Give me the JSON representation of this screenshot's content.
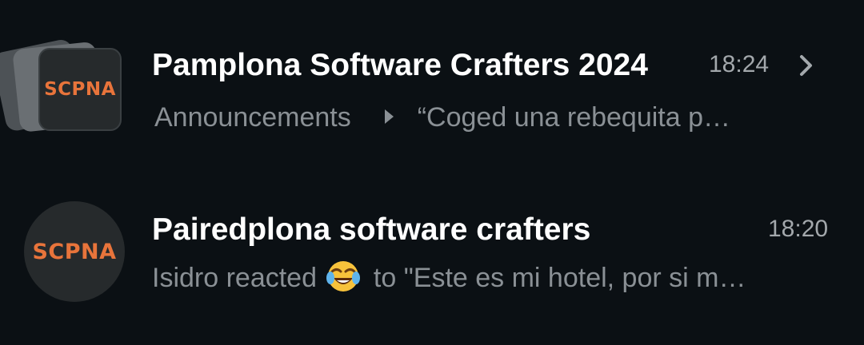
{
  "colors": {
    "background": "#0b1014",
    "title": "#ffffff",
    "secondary": "#8a9095",
    "time": "#a3a8ac",
    "logo_orange": "#e8743b",
    "avatar_bg": "#262a2c"
  },
  "chats": [
    {
      "type": "community",
      "avatar_text": "SCPNA",
      "title": "Pamplona Software Crafters 2024",
      "time": "18:24",
      "subgroup": "Announcements",
      "preview": "“Coged una rebequita p…",
      "icons": [
        "chevron-right-icon",
        "caret-icon"
      ]
    },
    {
      "type": "group",
      "avatar_text": "SCPNA",
      "title": "Pairedplona software crafters",
      "time": "18:20",
      "preview_prefix": "Isidro reacted",
      "preview_emoji": "face-with-tears-of-joy-icon",
      "preview_suffix": "to \"Este es mi hotel, por si m…"
    }
  ]
}
